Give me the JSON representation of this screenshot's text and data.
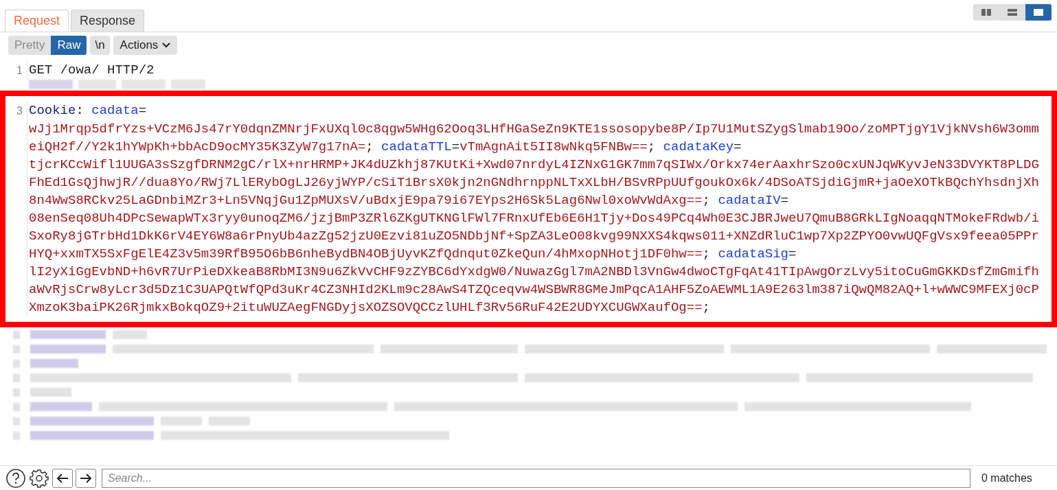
{
  "tabs": [
    {
      "label": "Request",
      "selected": true
    },
    {
      "label": "Response",
      "selected": false
    }
  ],
  "layout_buttons": [
    {
      "kind": "columns",
      "selected": false
    },
    {
      "kind": "rows",
      "selected": false
    },
    {
      "kind": "single",
      "selected": true
    }
  ],
  "toolbar": {
    "views": [
      {
        "label": "Pretty",
        "selected": false
      },
      {
        "label": "Raw",
        "selected": true
      }
    ],
    "newline": "\\n",
    "actions": "Actions"
  },
  "lines": [
    {
      "number": "1",
      "highlighted": false,
      "wrapped_rows": [
        {
          "segments": [
            {
              "kind": "plain",
              "text": "GET /owa/ HTTP/2"
            }
          ]
        }
      ]
    },
    {
      "number": "3",
      "highlighted": true,
      "wrapped_rows": [
        {
          "segments": [
            {
              "kind": "header",
              "text": "Cookie"
            },
            {
              "kind": "plain",
              "text": ": "
            },
            {
              "kind": "name",
              "text": "cadata"
            },
            {
              "kind": "plain",
              "text": "="
            }
          ]
        },
        {
          "segments": [
            {
              "kind": "value",
              "text": "wJj1Mrqp5dfrYzs+VCzM6Js47rY0dqnZMNrjFxUXql0c8qgw5WHg62Ooq3LHfHGaSeZn9KTE1ssosopybe8P/Ip7U1MutSZygSlmab19Oo/zoMPTjgY1VjkNVsh6W3omm"
            }
          ]
        },
        {
          "segments": [
            {
              "kind": "value",
              "text": "eiQH2f//Y2k1hYWpKh+bbAcD9ocMY35K3ZyW7g17nA="
            },
            {
              "kind": "plain",
              "text": "; "
            },
            {
              "kind": "name",
              "text": "cadataTTL"
            },
            {
              "kind": "plain",
              "text": "="
            },
            {
              "kind": "value",
              "text": "vTmAgnAit5II8wNkq5FNBw=="
            },
            {
              "kind": "plain",
              "text": "; "
            },
            {
              "kind": "name",
              "text": "cadataKey"
            },
            {
              "kind": "plain",
              "text": "="
            }
          ]
        },
        {
          "segments": [
            {
              "kind": "value",
              "text": "tjcrKCcWifl1UUGA3sSzgfDRNM2gC/rlX+nrHRMP+JK4dUZkhj87KUtKi+Xwd07nrdyL4IZNxG1GK7mm7qSIWx/Orkx74erAaxhrSzo0cxUNJqWKyvJeN33DVYKT8PLDG"
            }
          ]
        },
        {
          "segments": [
            {
              "kind": "value",
              "text": "FhEd1GsQjhwjR//dua8Yo/RWj7LlERybOgLJ26yjWYP/cSiT1BrsX0kjn2nGNdhrnppNLTxXLbH/BSvRPpUUfgoukOx6k/4DSoATSjdiGjmR+jaOeXOTkBQchYhsdnjXh"
            }
          ]
        },
        {
          "segments": [
            {
              "kind": "value",
              "text": "8n4WwS8RCkv25LaGDnbiMZr3+Ln5VNqjGu1ZpMUXsV/uBdxjE9pa79i67EYps2H6Sk5Lag6Nwl0xoWvWdAxg=="
            },
            {
              "kind": "plain",
              "text": "; "
            },
            {
              "kind": "name",
              "text": "cadataIV"
            },
            {
              "kind": "plain",
              "text": "="
            }
          ]
        },
        {
          "segments": [
            {
              "kind": "value",
              "text": "08enSeq08Uh4DPcSewapWTx3ryy0unoqZM6/jzjBmP3ZRl6ZKgUTKNGlFWl7FRnxUfEb6E6H1Tjy+Dos49PCq4Wh0E3CJBRJweU7QmuB8GRkLIgNoaqqNTMokeFRdwb/i"
            }
          ]
        },
        {
          "segments": [
            {
              "kind": "value",
              "text": "SxoRy8jGTrbHd1DkK6rV4EY6W8a6rPnyUb4azZg52jzU0Ezvi81uZO5NDbjNf+SpZA3LeO08kvg99NXXS4kqws011+XNZdRluC1wp7Xp2ZPYO0vwUQFgVsx9feea05PPr"
            }
          ]
        },
        {
          "segments": [
            {
              "kind": "value",
              "text": "HYQ+xxmTX5SxFgElE4Z3v5m39RfB95O6bB6nheBydBN4OBjUyvKZfQdnqut0ZkeQun/4hMxopNHotj1DF0hw=="
            },
            {
              "kind": "plain",
              "text": "; "
            },
            {
              "kind": "name",
              "text": "cadataSig"
            },
            {
              "kind": "plain",
              "text": "="
            }
          ]
        },
        {
          "segments": [
            {
              "kind": "value",
              "text": "lI2yXiGgEvbND+h6vR7UrPieDXkeaB8RbMI3N9u6ZkVvCHF9zZYBC6dYxdgW0/NuwazGgl7mA2NBDl3VnGw4dwoCTgFqAt41TIpAwgOrzLvy5itoCuGmGKKDsfZmGmifh"
            }
          ]
        },
        {
          "segments": [
            {
              "kind": "value",
              "text": "aWvRjsCrw8yLcr3d5Dz1C3UAPQtWfQPd3uKr4CZ3NHId2KLm9c28AwS4TZQceqvw4WSBWR8GMeJmPqcA1AHF5ZoAEWML1A9E263lm387iQwQM82AQ+l+wWWC9MFEXj0cP"
            }
          ]
        },
        {
          "segments": [
            {
              "kind": "value",
              "text": "XmzoK3baiPK26RjmkxBokqOZ9+2ituWUZAegFNGDyjsXOZSOVQCCzlUHLf3Rv56RuF42E2UDYXCUGWXaufOg=="
            },
            {
              "kind": "plain",
              "text": ";"
            }
          ]
        }
      ]
    }
  ],
  "search": {
    "placeholder": "Search...",
    "matches": "0 matches"
  }
}
